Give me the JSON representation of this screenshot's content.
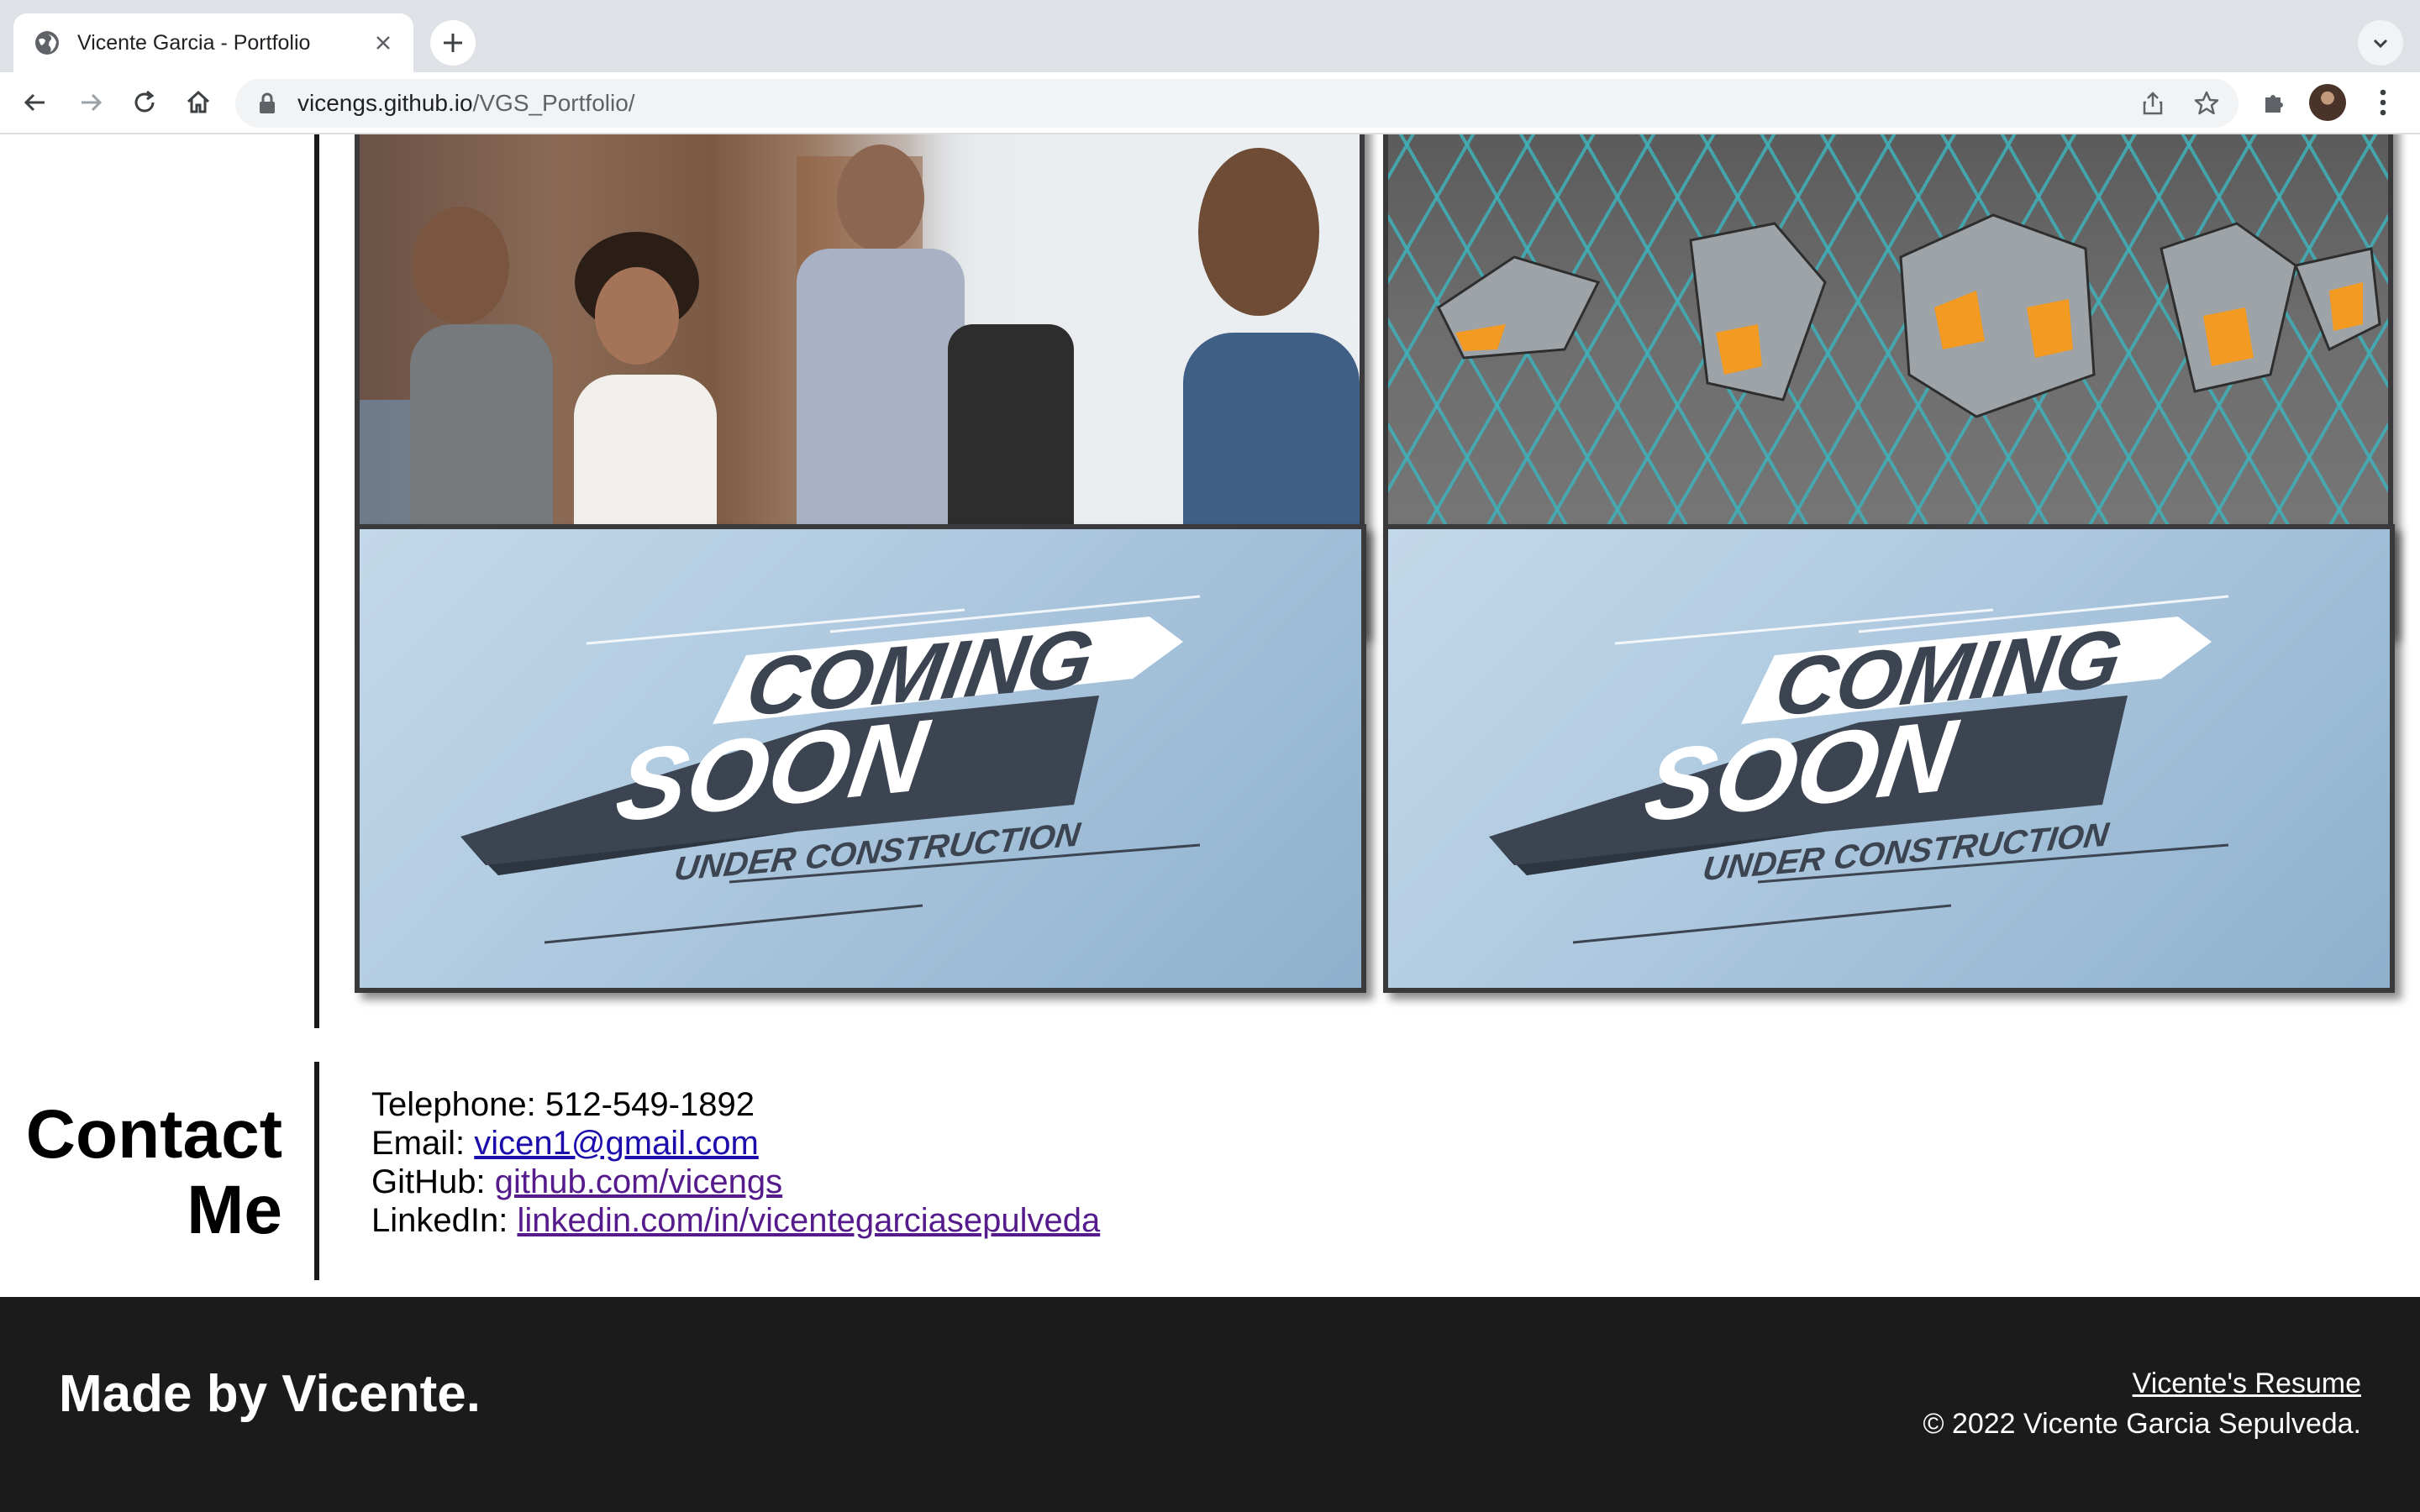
{
  "browser": {
    "tab_title": "Vicente Garcia - Portfolio",
    "url_host": "vicengs.github.io",
    "url_path": "/VGS_Portfolio/"
  },
  "projects": {
    "cards": [
      {
        "image": "team-meeting-photo"
      },
      {
        "image": "robots-hex-grid-render"
      },
      {
        "image": "coming-soon-banner",
        "line1": "COMING",
        "line2": "SOON",
        "line3": "UNDER CONSTRUCTION"
      },
      {
        "image": "coming-soon-banner",
        "line1": "COMING",
        "line2": "SOON",
        "line3": "UNDER CONSTRUCTION"
      }
    ]
  },
  "contact": {
    "heading_line1": "Contact",
    "heading_line2": "Me",
    "telephone_label": "Telephone:",
    "telephone_value": "512-549-1892",
    "email_label": "Email:",
    "email_value": "vicen1@gmail.com",
    "github_label": "GitHub:",
    "github_value": "github.com/vicengs",
    "linkedin_label": "LinkedIn:",
    "linkedin_value": "linkedin.com/in/vicentegarciasepulveda"
  },
  "footer": {
    "made_by": "Made by Vicente.",
    "resume_link": "Vicente's Resume",
    "copyright": "© 2022 Vicente Garcia Sepulveda."
  },
  "colors": {
    "footer_bg": "#1b1b1b",
    "link": "#1a0dab",
    "link_visited": "#551a8b",
    "card_border": "#3a3a3c",
    "banner_dark": "#3b4450"
  }
}
